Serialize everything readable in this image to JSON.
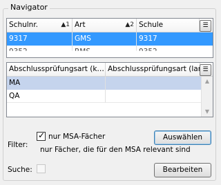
{
  "navigator": {
    "title": "Navigator",
    "grid1": {
      "columns": [
        {
          "label": "Schulnr.",
          "sort": "▲1"
        },
        {
          "label": "Art",
          "sort": "▲2"
        },
        {
          "label": "Schule",
          "sort": ""
        }
      ],
      "rows": [
        [
          "9317",
          "GMS",
          "9317"
        ],
        [
          "9352",
          "RMS",
          "9352"
        ]
      ],
      "column_chooser_icon": "column-chooser-icon"
    },
    "grid2": {
      "columns": [
        {
          "label": "Abschlussprüfungsart (k…"
        },
        {
          "label": "Abschlussprüfungsart (lang)"
        }
      ],
      "rows": [
        [
          "MA",
          ""
        ],
        [
          "QA",
          ""
        ]
      ],
      "column_chooser_icon": "column-chooser-icon"
    },
    "filter": {
      "label": "Filter:",
      "checkbox_label": "nur MSA-Fächer",
      "checked": true,
      "description": "nur Fächer, die für den MSA relevant sind",
      "button": "Auswählen"
    },
    "search": {
      "label": "Suche:",
      "checked": false,
      "button": "Bearbeiten"
    }
  }
}
